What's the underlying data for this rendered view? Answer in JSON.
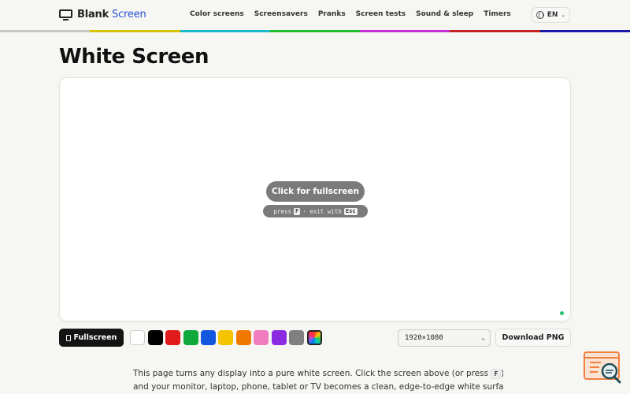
{
  "brand": {
    "name_a": "Blank",
    "name_b": "Screen"
  },
  "nav": [
    "Color screens",
    "Screensavers",
    "Pranks",
    "Screen tests",
    "Sound & sleep",
    "Timers"
  ],
  "lang": "EN",
  "rainbow_colors": [
    "#c8c8c8",
    "#d6c400",
    "#1cb8d0",
    "#1fbf2b",
    "#c82bd6",
    "#c42323",
    "#1a1aa6"
  ],
  "title": "White Screen",
  "stage": {
    "cta": "Click for fullscreen",
    "hint_press": "press",
    "hint_key_f": "F",
    "hint_mid": "· exit with",
    "hint_key_esc": "Esc"
  },
  "toolbar": {
    "fullscreen_label": "Fullscreen",
    "swatches": [
      "#ffffff",
      "#000000",
      "#e11b1b",
      "#0ea93a",
      "#1356e0",
      "#f5c400",
      "#f07800",
      "#f07cc0",
      "#8a2be2",
      "#808080",
      "rainbow"
    ],
    "resolution": "1920×1080",
    "download_label": "Download PNG"
  },
  "description": {
    "line1_a": "This page turns any display into a pure white screen. Click the screen above (or press",
    "line1_key": "F",
    "line1_b": ")",
    "line2": "and your monitor, laptop, phone, tablet or TV becomes a clean, edge-to-edge white surface"
  }
}
